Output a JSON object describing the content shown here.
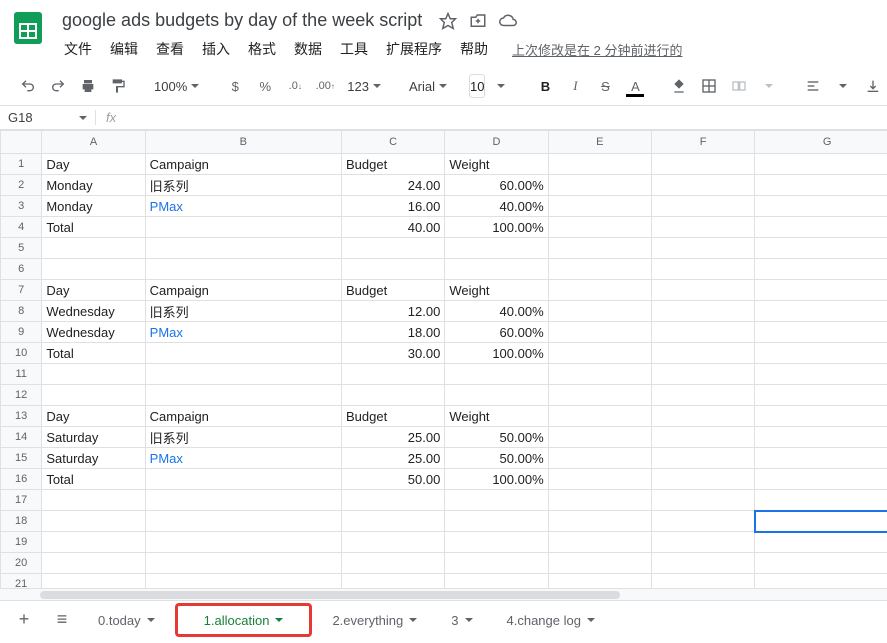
{
  "header": {
    "title": "google ads budgets by day of the week script"
  },
  "menubar": {
    "items": [
      "文件",
      "编辑",
      "查看",
      "插入",
      "格式",
      "数据",
      "工具",
      "扩展程序",
      "帮助"
    ],
    "last_edit": "上次修改是在 2 分钟前进行的"
  },
  "toolbar": {
    "zoom": "100%",
    "currency": "$",
    "percent": "%",
    "dec_less": ".0",
    "dec_more": ".00",
    "num_fmt": "123",
    "font": "Arial",
    "font_size": "10",
    "bold": "B",
    "italic": "I",
    "strike": "S",
    "text_color": "A"
  },
  "namebox": {
    "cell": "G18",
    "fx": "fx"
  },
  "columns": [
    "A",
    "B",
    "C",
    "D",
    "E",
    "F",
    "G"
  ],
  "rows": [
    {
      "n": 1,
      "A": "Day",
      "B": "Campaign",
      "C": "Budget",
      "D": "Weight"
    },
    {
      "n": 2,
      "A": "Monday",
      "B": "旧系列",
      "C": "24.00",
      "D": "60.00%"
    },
    {
      "n": 3,
      "A": "Monday",
      "B": "PMax",
      "Blink": true,
      "C": "16.00",
      "D": "40.00%"
    },
    {
      "n": 4,
      "A": "Total",
      "B": "",
      "C": "40.00",
      "D": "100.00%"
    },
    {
      "n": 5
    },
    {
      "n": 6
    },
    {
      "n": 7,
      "A": "Day",
      "B": "Campaign",
      "C": "Budget",
      "D": "Weight"
    },
    {
      "n": 8,
      "A": "Wednesday",
      "B": "旧系列",
      "C": "12.00",
      "D": "40.00%"
    },
    {
      "n": 9,
      "A": "Wednesday",
      "B": "PMax",
      "Blink": true,
      "C": "18.00",
      "D": "60.00%"
    },
    {
      "n": 10,
      "A": "Total",
      "B": "",
      "C": "30.00",
      "D": "100.00%"
    },
    {
      "n": 11
    },
    {
      "n": 12
    },
    {
      "n": 13,
      "A": "Day",
      "B": "Campaign",
      "C": "Budget",
      "D": "Weight"
    },
    {
      "n": 14,
      "A": "Saturday",
      "B": "旧系列",
      "C": "25.00",
      "D": "50.00%"
    },
    {
      "n": 15,
      "A": "Saturday",
      "B": "PMax",
      "Blink": true,
      "C": "25.00",
      "D": "50.00%"
    },
    {
      "n": 16,
      "A": "Total",
      "B": "",
      "C": "50.00",
      "D": "100.00%"
    },
    {
      "n": 17
    },
    {
      "n": 18
    },
    {
      "n": 19
    },
    {
      "n": 20
    },
    {
      "n": 21
    }
  ],
  "selected": {
    "row": 18,
    "col": "G"
  },
  "sheets": [
    {
      "name": "0.today"
    },
    {
      "name": "1.allocation",
      "active": true,
      "highlight": true
    },
    {
      "name": "2.everything"
    },
    {
      "name": "3"
    },
    {
      "name": "4.change log"
    }
  ]
}
